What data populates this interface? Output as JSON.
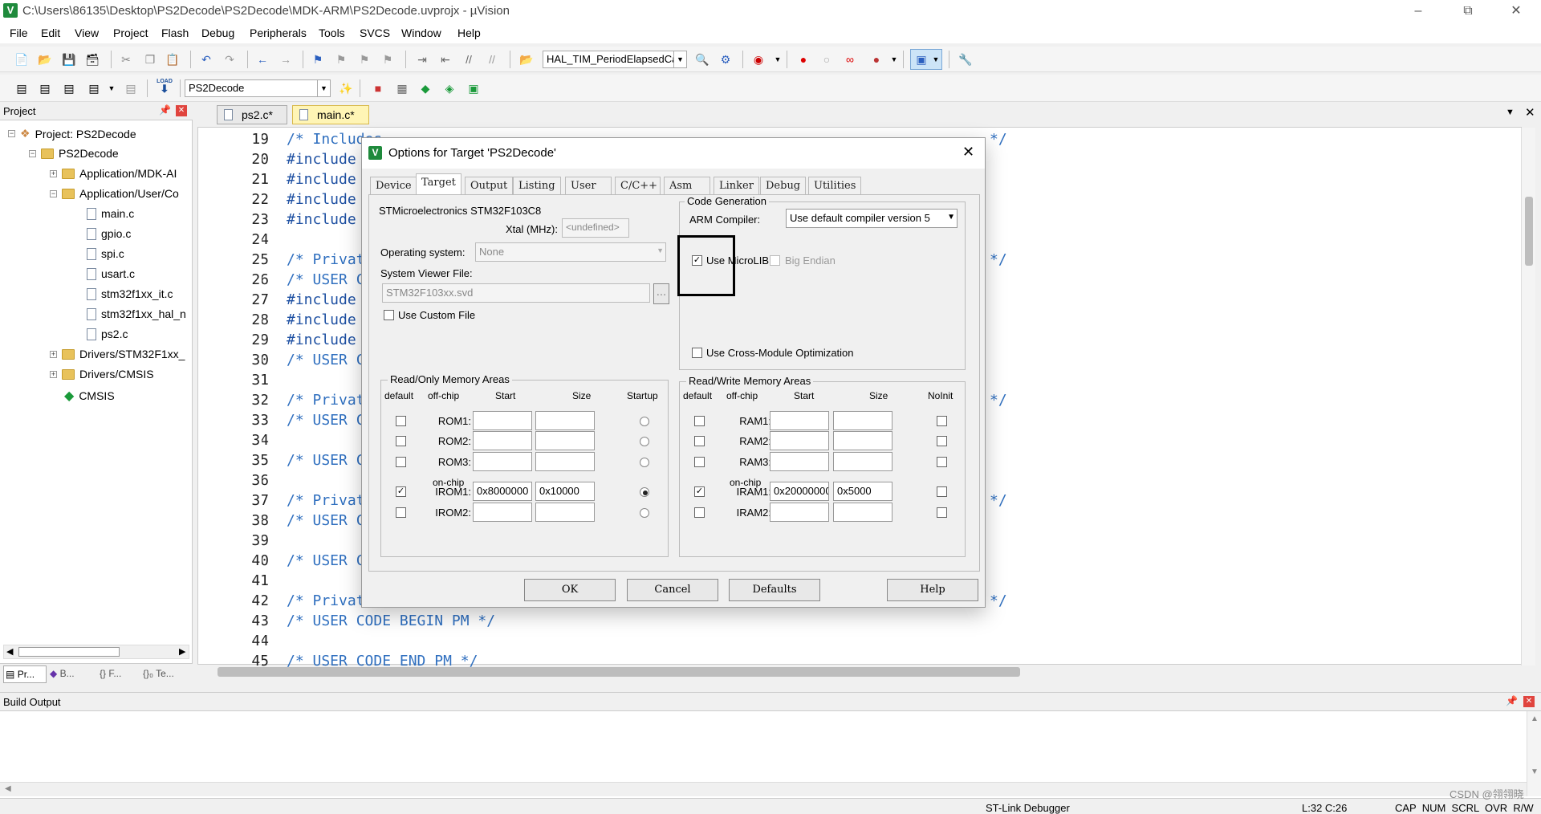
{
  "window": {
    "title": "C:\\Users\\86135\\Desktop\\PS2Decode\\PS2Decode\\MDK-ARM\\PS2Decode.uvprojx - µVision",
    "app_icon": "V"
  },
  "menu": [
    "File",
    "Edit",
    "View",
    "Project",
    "Flash",
    "Debug",
    "Peripherals",
    "Tools",
    "SVCS",
    "Window",
    "Help"
  ],
  "toolbar1": {
    "function_combo": "HAL_TIM_PeriodElapsedCall"
  },
  "toolbar2": {
    "target_combo": "PS2Decode",
    "load_label": "LOAD"
  },
  "project_pane": {
    "title": "Project",
    "tree": [
      {
        "label": "Project: PS2Decode"
      },
      {
        "label": "PS2Decode"
      },
      {
        "label": "Application/MDK-AI"
      },
      {
        "label": "Application/User/Co"
      },
      {
        "label": "main.c"
      },
      {
        "label": "gpio.c"
      },
      {
        "label": "spi.c"
      },
      {
        "label": "usart.c"
      },
      {
        "label": "stm32f1xx_it.c"
      },
      {
        "label": "stm32f1xx_hal_n"
      },
      {
        "label": "ps2.c"
      },
      {
        "label": "Drivers/STM32F1xx_"
      },
      {
        "label": "Drivers/CMSIS"
      },
      {
        "label": "CMSIS"
      }
    ],
    "bottom_tabs": [
      "Pr...",
      "B...",
      "{} F...",
      "{}₀ Te..."
    ]
  },
  "editor": {
    "tabs": [
      "ps2.c*",
      "main.c*"
    ],
    "lines": [
      {
        "n": "19",
        "t": "/* Includes"
      },
      {
        "n": "20",
        "t": "#include"
      },
      {
        "n": "21",
        "t": "#include"
      },
      {
        "n": "22",
        "t": "#include"
      },
      {
        "n": "23",
        "t": "#include"
      },
      {
        "n": "24",
        "t": ""
      },
      {
        "n": "25",
        "t": "/* Privat"
      },
      {
        "n": "26",
        "t": "/* USER C"
      },
      {
        "n": "27",
        "t": "#include"
      },
      {
        "n": "28",
        "t": "#include"
      },
      {
        "n": "29",
        "t": "#include"
      },
      {
        "n": "30",
        "t": "/* USER C"
      },
      {
        "n": "31",
        "t": ""
      },
      {
        "n": "32",
        "t": "/* Privat"
      },
      {
        "n": "33",
        "t": "/* USER C"
      },
      {
        "n": "34",
        "t": ""
      },
      {
        "n": "35",
        "t": "/* USER C"
      },
      {
        "n": "36",
        "t": ""
      },
      {
        "n": "37",
        "t": "/* Privat"
      },
      {
        "n": "38",
        "t": "/* USER C"
      },
      {
        "n": "39",
        "t": ""
      },
      {
        "n": "40",
        "t": "/* USER C"
      },
      {
        "n": "41",
        "t": ""
      },
      {
        "n": "42",
        "t": "/* Privat"
      },
      {
        "n": "43",
        "t": "/* USER CODE BEGIN PM */"
      },
      {
        "n": "44",
        "t": ""
      },
      {
        "n": "45",
        "t": "/* USER CODE END PM */"
      }
    ],
    "right_comment_end": "*/"
  },
  "dialog": {
    "title": "Options for Target 'PS2Decode'",
    "tabs": [
      "Device",
      "Target",
      "Output",
      "Listing",
      "User",
      "C/C++",
      "Asm",
      "Linker",
      "Debug",
      "Utilities"
    ],
    "active_tab": "Target",
    "device": "STMicroelectronics STM32F103C8",
    "xtal_label": "Xtal (MHz):",
    "xtal_value": "<undefined>",
    "os_label": "Operating system:",
    "os_value": "None",
    "svd_label": "System Viewer File:",
    "svd_value": "STM32F103xx.svd",
    "browse": "...",
    "custom_file_label": "Use Custom File",
    "code_gen": {
      "title": "Code Generation",
      "compiler_label": "ARM Compiler:",
      "compiler_value": "Use default compiler version 5",
      "microlib_label": "Use MicroLIB",
      "microlib_checked": true,
      "big_endian_label": "Big Endian",
      "cross_module_label": "Use Cross-Module Optimization"
    },
    "ro": {
      "title": "Read/Only Memory Areas",
      "headers": {
        "default": "default",
        "offchip": "off-chip",
        "start": "Start",
        "size": "Size",
        "startup": "Startup"
      },
      "onchip": "on-chip",
      "rows": [
        {
          "label": "ROM1:",
          "start": "",
          "size": "",
          "default": false,
          "startup": false
        },
        {
          "label": "ROM2:",
          "start": "",
          "size": "",
          "default": false,
          "startup": false
        },
        {
          "label": "ROM3:",
          "start": "",
          "size": "",
          "default": false,
          "startup": false
        },
        {
          "label": "IROM1:",
          "start": "0x8000000",
          "size": "0x10000",
          "default": true,
          "startup": true
        },
        {
          "label": "IROM2:",
          "start": "",
          "size": "",
          "default": false,
          "startup": false
        }
      ]
    },
    "rw": {
      "title": "Read/Write Memory Areas",
      "headers": {
        "default": "default",
        "offchip": "off-chip",
        "start": "Start",
        "size": "Size",
        "noinit": "NoInit"
      },
      "onchip": "on-chip",
      "rows": [
        {
          "label": "RAM1:",
          "start": "",
          "size": "",
          "default": false
        },
        {
          "label": "RAM2:",
          "start": "",
          "size": "",
          "default": false
        },
        {
          "label": "RAM3:",
          "start": "",
          "size": "",
          "default": false
        },
        {
          "label": "IRAM1:",
          "start": "0x20000000",
          "size": "0x5000",
          "default": true
        },
        {
          "label": "IRAM2:",
          "start": "",
          "size": "",
          "default": false
        }
      ]
    },
    "buttons": {
      "ok": "OK",
      "cancel": "Cancel",
      "defaults": "Defaults",
      "help": "Help"
    }
  },
  "build_output": {
    "title": "Build Output"
  },
  "status": {
    "debugger": "ST-Link Debugger",
    "position": "L:32 C:26",
    "flags": "CAP  NUM  SCRL  OVR  R/W",
    "watermark": "CSDN @翎翎晓"
  }
}
